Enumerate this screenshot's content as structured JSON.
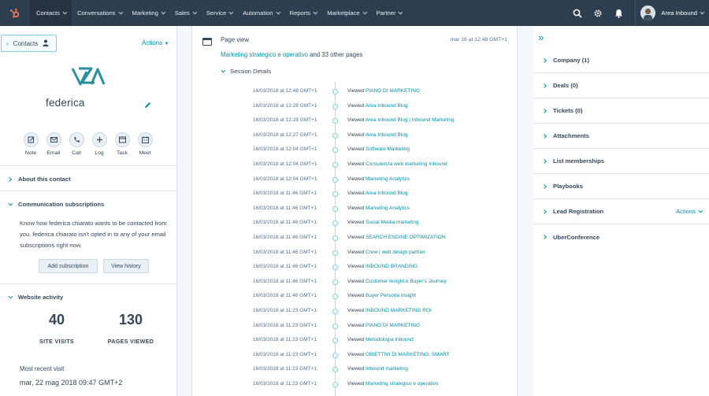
{
  "nav": {
    "items": [
      "Contacts",
      "Conversations",
      "Marketing",
      "Sales",
      "Service",
      "Automation",
      "Reports",
      "Marketplace",
      "Partner"
    ],
    "account": "Area Inbound"
  },
  "contact": {
    "back_label": "Contacts",
    "actions_label": "Actions",
    "name": "federica",
    "quick_actions": [
      "Note",
      "Email",
      "Call",
      "Log",
      "Task",
      "Meet"
    ]
  },
  "left_sections": {
    "about": "About this contact",
    "comm": "Communication subscriptions",
    "comm_text": "Know how federica chiarato wants to be contacted from you. federica chiarato isn't opted in to any of your email subscriptions right now.",
    "add_subscription": "Add subscription",
    "view_history": "View history",
    "website_activity": "Website activity",
    "site_visits_value": "40",
    "site_visits_label": "SITE VISITS",
    "pages_viewed_value": "130",
    "pages_viewed_label": "PAGES VIEWED",
    "recent_visit_label": "Most recent visit",
    "recent_visit_value": "mar, 22 mag 2018 09:47 GMT+2"
  },
  "page_view": {
    "title": "Page view",
    "date": "mar 16 at 12:48 GMT+1",
    "summary_link": "Marketing strategico e operativo",
    "summary_rest": " and 33 other pages",
    "session_label": "Session Details",
    "viewed_prefix": "Viewed ",
    "rows": [
      {
        "ts": "16/03/2018 at 12:48 GMT+1",
        "page": "PIANO DI MARKETING"
      },
      {
        "ts": "16/03/2018 at 12:28 GMT+1",
        "page": "Area Inbound Blog"
      },
      {
        "ts": "16/03/2018 at 12:28 GMT+1",
        "page": "Area Inbound Blog | Inbound Marketing"
      },
      {
        "ts": "16/03/2018 at 12:27 GMT+1",
        "page": "Area Inbound Blog"
      },
      {
        "ts": "16/03/2018 at 12:04 GMT+1",
        "page": "Software Marketing"
      },
      {
        "ts": "16/03/2018 at 12:04 GMT+1",
        "page": "Consulenza web marketing Inbound"
      },
      {
        "ts": "16/03/2018 at 12:04 GMT+1",
        "page": "Marketing Analytics"
      },
      {
        "ts": "16/03/2018 at 11:46 GMT+1",
        "page": "Area Inbound Blog"
      },
      {
        "ts": "16/03/2018 at 11:46 GMT+1",
        "page": "Marketing Analytics"
      },
      {
        "ts": "16/03/2018 at 11:46 GMT+1",
        "page": "Social Media marketing"
      },
      {
        "ts": "16/03/2018 at 11:46 GMT+1",
        "page": "SEARCH ENGINE OPTIMIZATION"
      },
      {
        "ts": "16/03/2018 at 11:46 GMT+1",
        "page": "Crew | web design partner"
      },
      {
        "ts": "16/03/2018 at 11:46 GMT+1",
        "page": "INBOUND BRANDING"
      },
      {
        "ts": "16/03/2018 at 11:46 GMT+1",
        "page": "Customer Insight e Buyer's Journey"
      },
      {
        "ts": "16/03/2018 at 11:46 GMT+1",
        "page": "Buyer Persona Insight"
      },
      {
        "ts": "16/03/2018 at 11:23 GMT+1",
        "page": "INBOUND MARKETING ROI"
      },
      {
        "ts": "16/03/2018 at 11:23 GMT+1",
        "page": "PIANO DI MARKETING"
      },
      {
        "ts": "16/03/2018 at 11:23 GMT+1",
        "page": "Metodologia Inbound"
      },
      {
        "ts": "16/03/2018 at 11:23 GMT+1",
        "page": "OBIETTIVI DI MARKETING: SMART"
      },
      {
        "ts": "16/03/2018 at 11:23 GMT+1",
        "page": "Inbound marketing"
      },
      {
        "ts": "16/03/2018 at 11:23 GMT+1",
        "page": "Marketing strategico e operativo"
      }
    ]
  },
  "right_sections": {
    "items": [
      "Company (1)",
      "Deals (0)",
      "Tickets (0)",
      "Attachments",
      "List memberships",
      "Playbooks",
      "Lead Registration",
      "UberConference"
    ],
    "lead_actions": "Actions"
  },
  "colors": {
    "nav_bg": "#2d3e50",
    "accent": "#0091ae",
    "brand_orange": "#ff7a59",
    "logo_teal": "#2a8f9e"
  }
}
